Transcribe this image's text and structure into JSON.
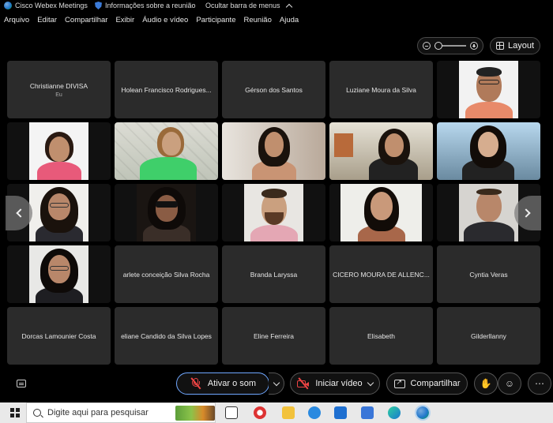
{
  "titlebar": {
    "app_name": "Cisco Webex Meetings",
    "info_label": "Informações sobre a reunião",
    "hide_menu_label": "Ocultar barra de menus"
  },
  "menu": [
    "Arquivo",
    "Editar",
    "Compartilhar",
    "Exibir",
    "Áudio e vídeo",
    "Participante",
    "Reunião",
    "Ajuda"
  ],
  "toolbar": {
    "layout_label": "Layout"
  },
  "participants": [
    {
      "name": "Christianne DIVISA",
      "sub": "Eu"
    },
    {
      "name": "Holean Francisco Rodrigues..."
    },
    {
      "name": "Gérson dos Santos"
    },
    {
      "name": "Luziane Moura da Silva"
    },
    {
      "name": "arlete conceição Silva Rocha"
    },
    {
      "name": "Branda Laryssa"
    },
    {
      "name": "CICERO MOURA DE ALLENC..."
    },
    {
      "name": "Cyntia Veras"
    },
    {
      "name": "Dorcas Lamounier Costa"
    },
    {
      "name": "eliane Candido da Silva Lopes"
    },
    {
      "name": "Eline Ferreira"
    },
    {
      "name": "Elisabeth"
    },
    {
      "name": "Gilderllanny"
    }
  ],
  "controls": {
    "unmute_label": "Ativar o som",
    "start_video_label": "Iniciar vídeo",
    "share_label": "Compartilhar"
  },
  "taskbar": {
    "search_placeholder": "Digite aqui para pesquisar"
  },
  "colors": {
    "tile_bg": "#2b2b2b",
    "accent_border": "#6fa7ff",
    "muted_red": "#e44444"
  }
}
